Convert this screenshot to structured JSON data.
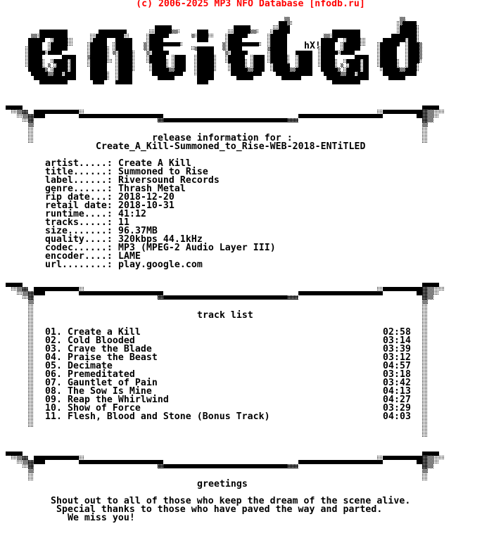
{
  "header": {
    "copyright": "(c) 2006-2025 MP3 NFO Database [nfodb.ru]",
    "copyright_color": "#ff0000"
  },
  "logo": {
    "text": "eNtitLeD",
    "tag": "hX!"
  },
  "release": {
    "heading": "release information for :",
    "name": "Create_A_Kill-Summoned_to_Rise-WEB-2018-ENTiTLED",
    "fields": [
      {
        "label": "artist.....:",
        "value": "Create A Kill"
      },
      {
        "label": "title......:",
        "value": "Summoned to Rise"
      },
      {
        "label": "label......:",
        "value": "Riversound Records"
      },
      {
        "label": "genre......:",
        "value": "Thrash Metal"
      },
      {
        "label": "rip date...:",
        "value": "2018-12-20"
      },
      {
        "label": "retail date:",
        "value": "2018-10-31"
      },
      {
        "label": "runtime....:",
        "value": "41:12"
      },
      {
        "label": "tracks.....:",
        "value": "11"
      },
      {
        "label": "size.......:",
        "value": "96.37MB"
      },
      {
        "label": "quality....:",
        "value": "320kbps 44.1kHz"
      },
      {
        "label": "codec......:",
        "value": "MP3 (MPEG-2 Audio Layer III)"
      },
      {
        "label": "encoder....:",
        "value": "LAME"
      },
      {
        "label": "url........:",
        "value": "play.google.com"
      }
    ]
  },
  "tracklist": {
    "heading": "track list",
    "tracks": [
      {
        "num": "01.",
        "title": "Create a Kill",
        "time": "02:58"
      },
      {
        "num": "02.",
        "title": "Cold Blooded",
        "time": "03:14"
      },
      {
        "num": "03.",
        "title": "Crave the Blade",
        "time": "03:39"
      },
      {
        "num": "04.",
        "title": "Praise the Beast",
        "time": "03:12"
      },
      {
        "num": "05.",
        "title": "Decimate",
        "time": "04:57"
      },
      {
        "num": "06.",
        "title": "Premeditated",
        "time": "03:18"
      },
      {
        "num": "07.",
        "title": "Gauntlet of Pain",
        "time": "03:42"
      },
      {
        "num": "08.",
        "title": "The Sow Is Mine",
        "time": "04:13"
      },
      {
        "num": "09.",
        "title": "Reap the Whirlwind",
        "time": "04:27"
      },
      {
        "num": "10.",
        "title": "Show of Force",
        "time": "03:29"
      },
      {
        "num": "11.",
        "title": "Flesh, Blood and Stone (Bonus Track)",
        "time": "04:03"
      }
    ]
  },
  "greetings": {
    "heading": "greetings",
    "lines": [
      "Shout out to all of those who keep the dream of the scene alive.",
      " Special thanks to those who have paved the way and parted.",
      "   We miss you!"
    ]
  }
}
